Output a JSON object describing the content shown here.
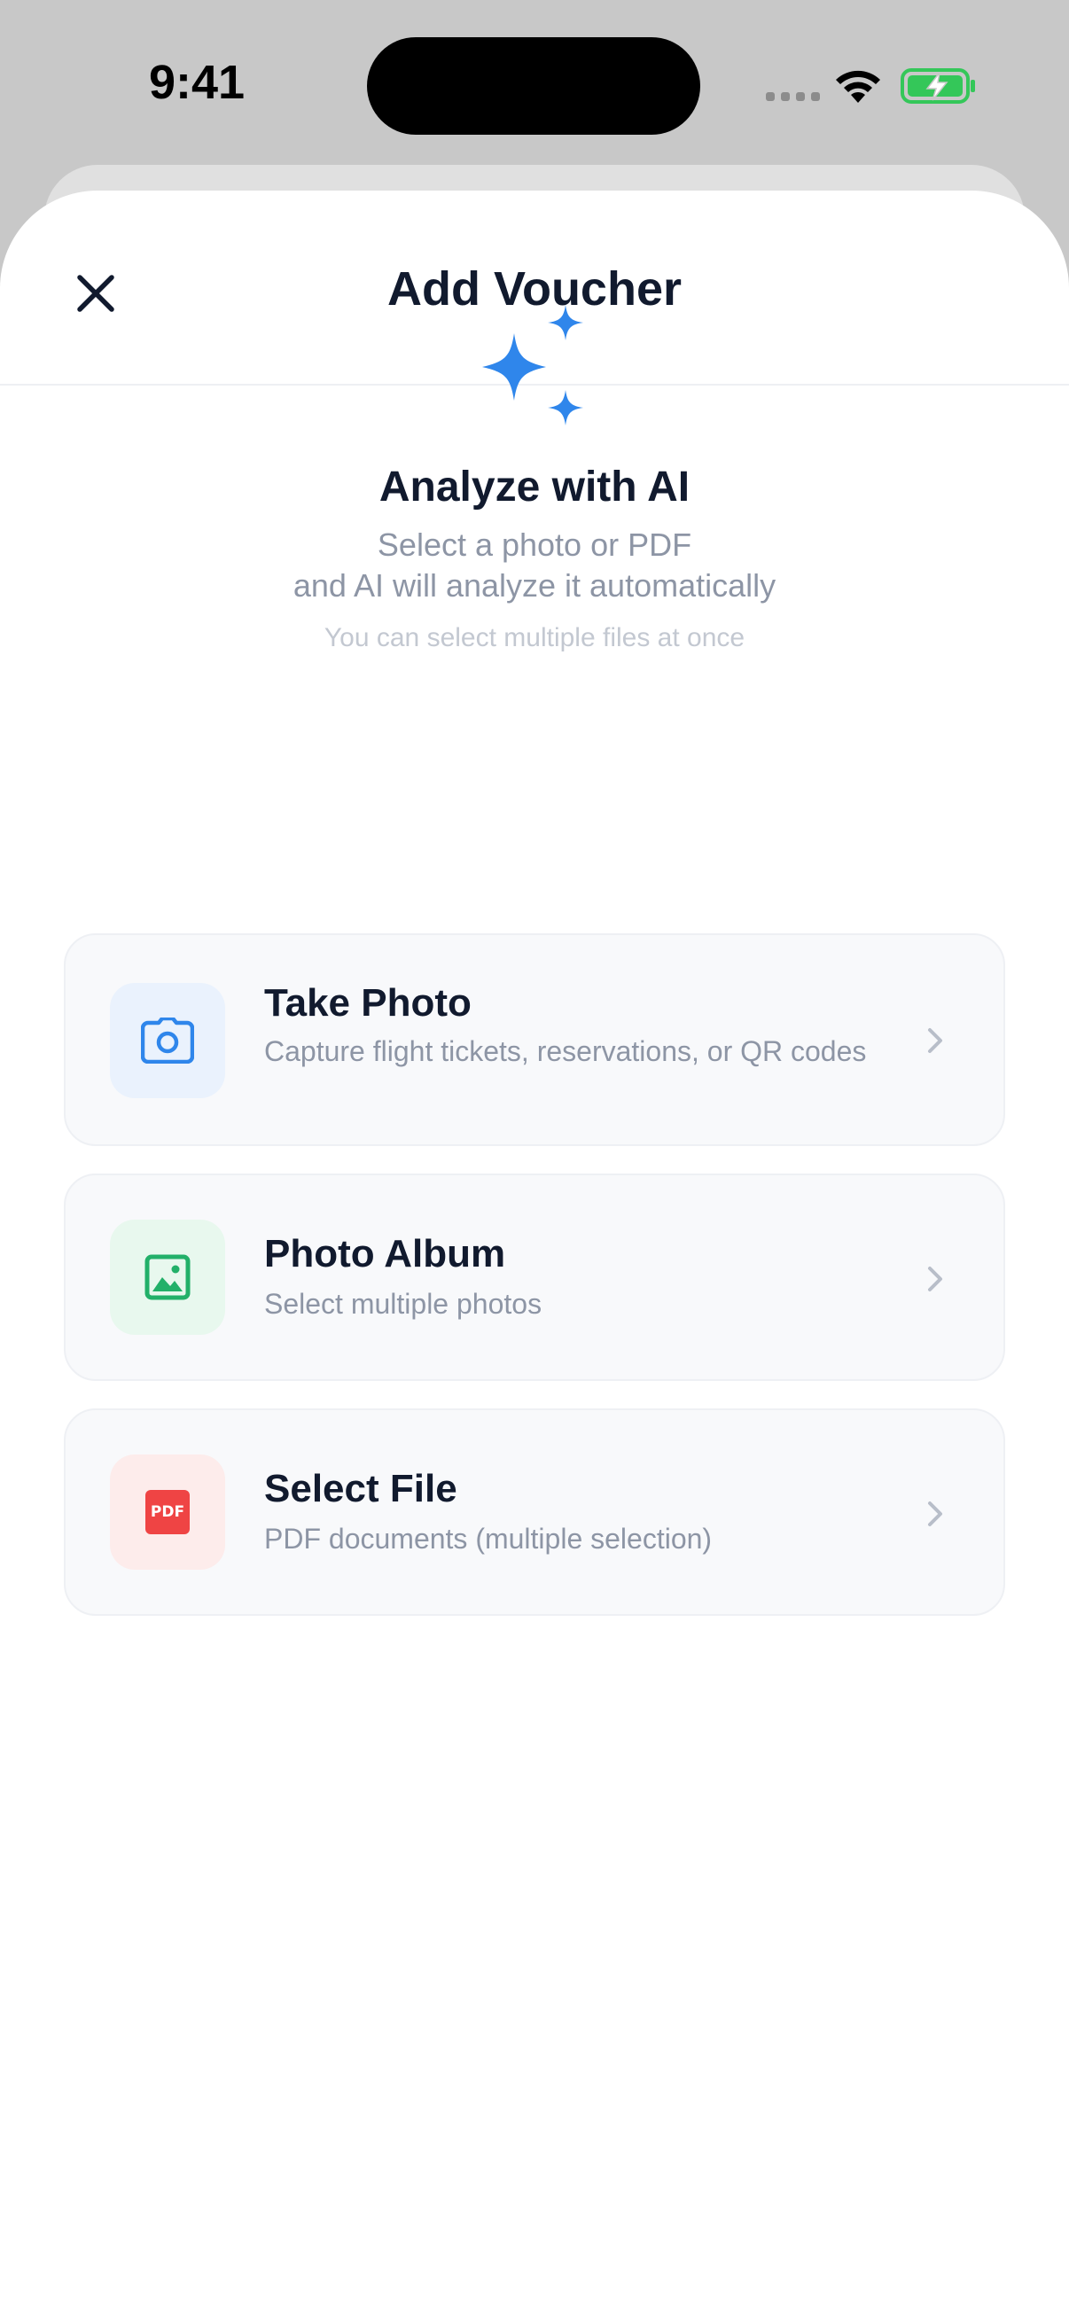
{
  "status_bar": {
    "time": "9:41",
    "icons": [
      "signal-dots-icon",
      "wifi-icon",
      "battery-charging-icon"
    ],
    "battery_color": "#34c759"
  },
  "header": {
    "title": "Add Voucher",
    "close_icon": "close-icon"
  },
  "hero": {
    "icon": "sparkles-icon",
    "icon_color": "#2f86eb",
    "title": "Analyze with AI",
    "subtitle_line1": "Select a photo or PDF",
    "subtitle_line2": "and AI will analyze it automatically",
    "note": "You can select multiple files at once"
  },
  "options": [
    {
      "icon": "camera-icon",
      "icon_color": "#2f86eb",
      "icon_bg": "#eaf2fd",
      "title": "Take Photo",
      "description": "Capture flight tickets, reservations, or QR codes"
    },
    {
      "icon": "image-icon",
      "icon_color": "#22b069",
      "icon_bg": "#e8f8ee",
      "title": "Photo Album",
      "description": "Select multiple photos"
    },
    {
      "icon": "pdf-icon",
      "icon_color": "#ef4444",
      "icon_bg": "#fdeceb",
      "icon_text": "PDF",
      "title": "Select File",
      "description": "PDF documents (multiple selection)"
    }
  ],
  "colors": {
    "title": "#111a2e",
    "secondary": "#8d95a5",
    "muted": "#c3c8d1",
    "card_bg": "#f8f9fb"
  }
}
